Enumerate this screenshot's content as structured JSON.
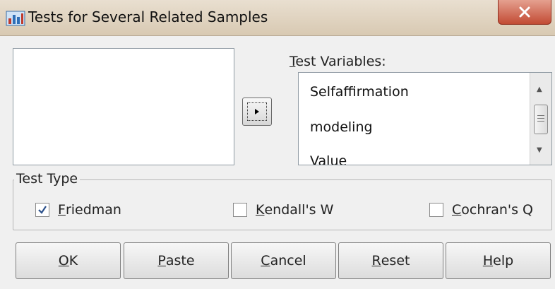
{
  "window": {
    "title": "Tests for Several Related Samples",
    "close_glyph": "X"
  },
  "source_list": {
    "items": []
  },
  "move_button": {
    "glyph": "▸"
  },
  "test_variables": {
    "label_accel": "T",
    "label_rest": "est Variables:",
    "items": [
      "Selfaffirmation",
      "modeling",
      "Value"
    ]
  },
  "test_type": {
    "legend": "Test Type",
    "options": [
      {
        "accel": "F",
        "rest": "riedman",
        "checked": true
      },
      {
        "accel": "K",
        "rest": "endall's W",
        "checked": false
      },
      {
        "accel": "C",
        "rest": "ochran's Q",
        "checked": false
      }
    ]
  },
  "buttons": [
    {
      "accel": "O",
      "rest": "K"
    },
    {
      "accel": "P",
      "rest": "aste"
    },
    {
      "accel": "C",
      "rest": "ancel"
    },
    {
      "accel": "R",
      "rest": "eset"
    },
    {
      "accel": "H",
      "rest": "elp"
    }
  ],
  "colors": {
    "title_gradient_top": "#e9dfd0",
    "close_red": "#c24b34",
    "dialog_bg": "#f0f0f0"
  }
}
